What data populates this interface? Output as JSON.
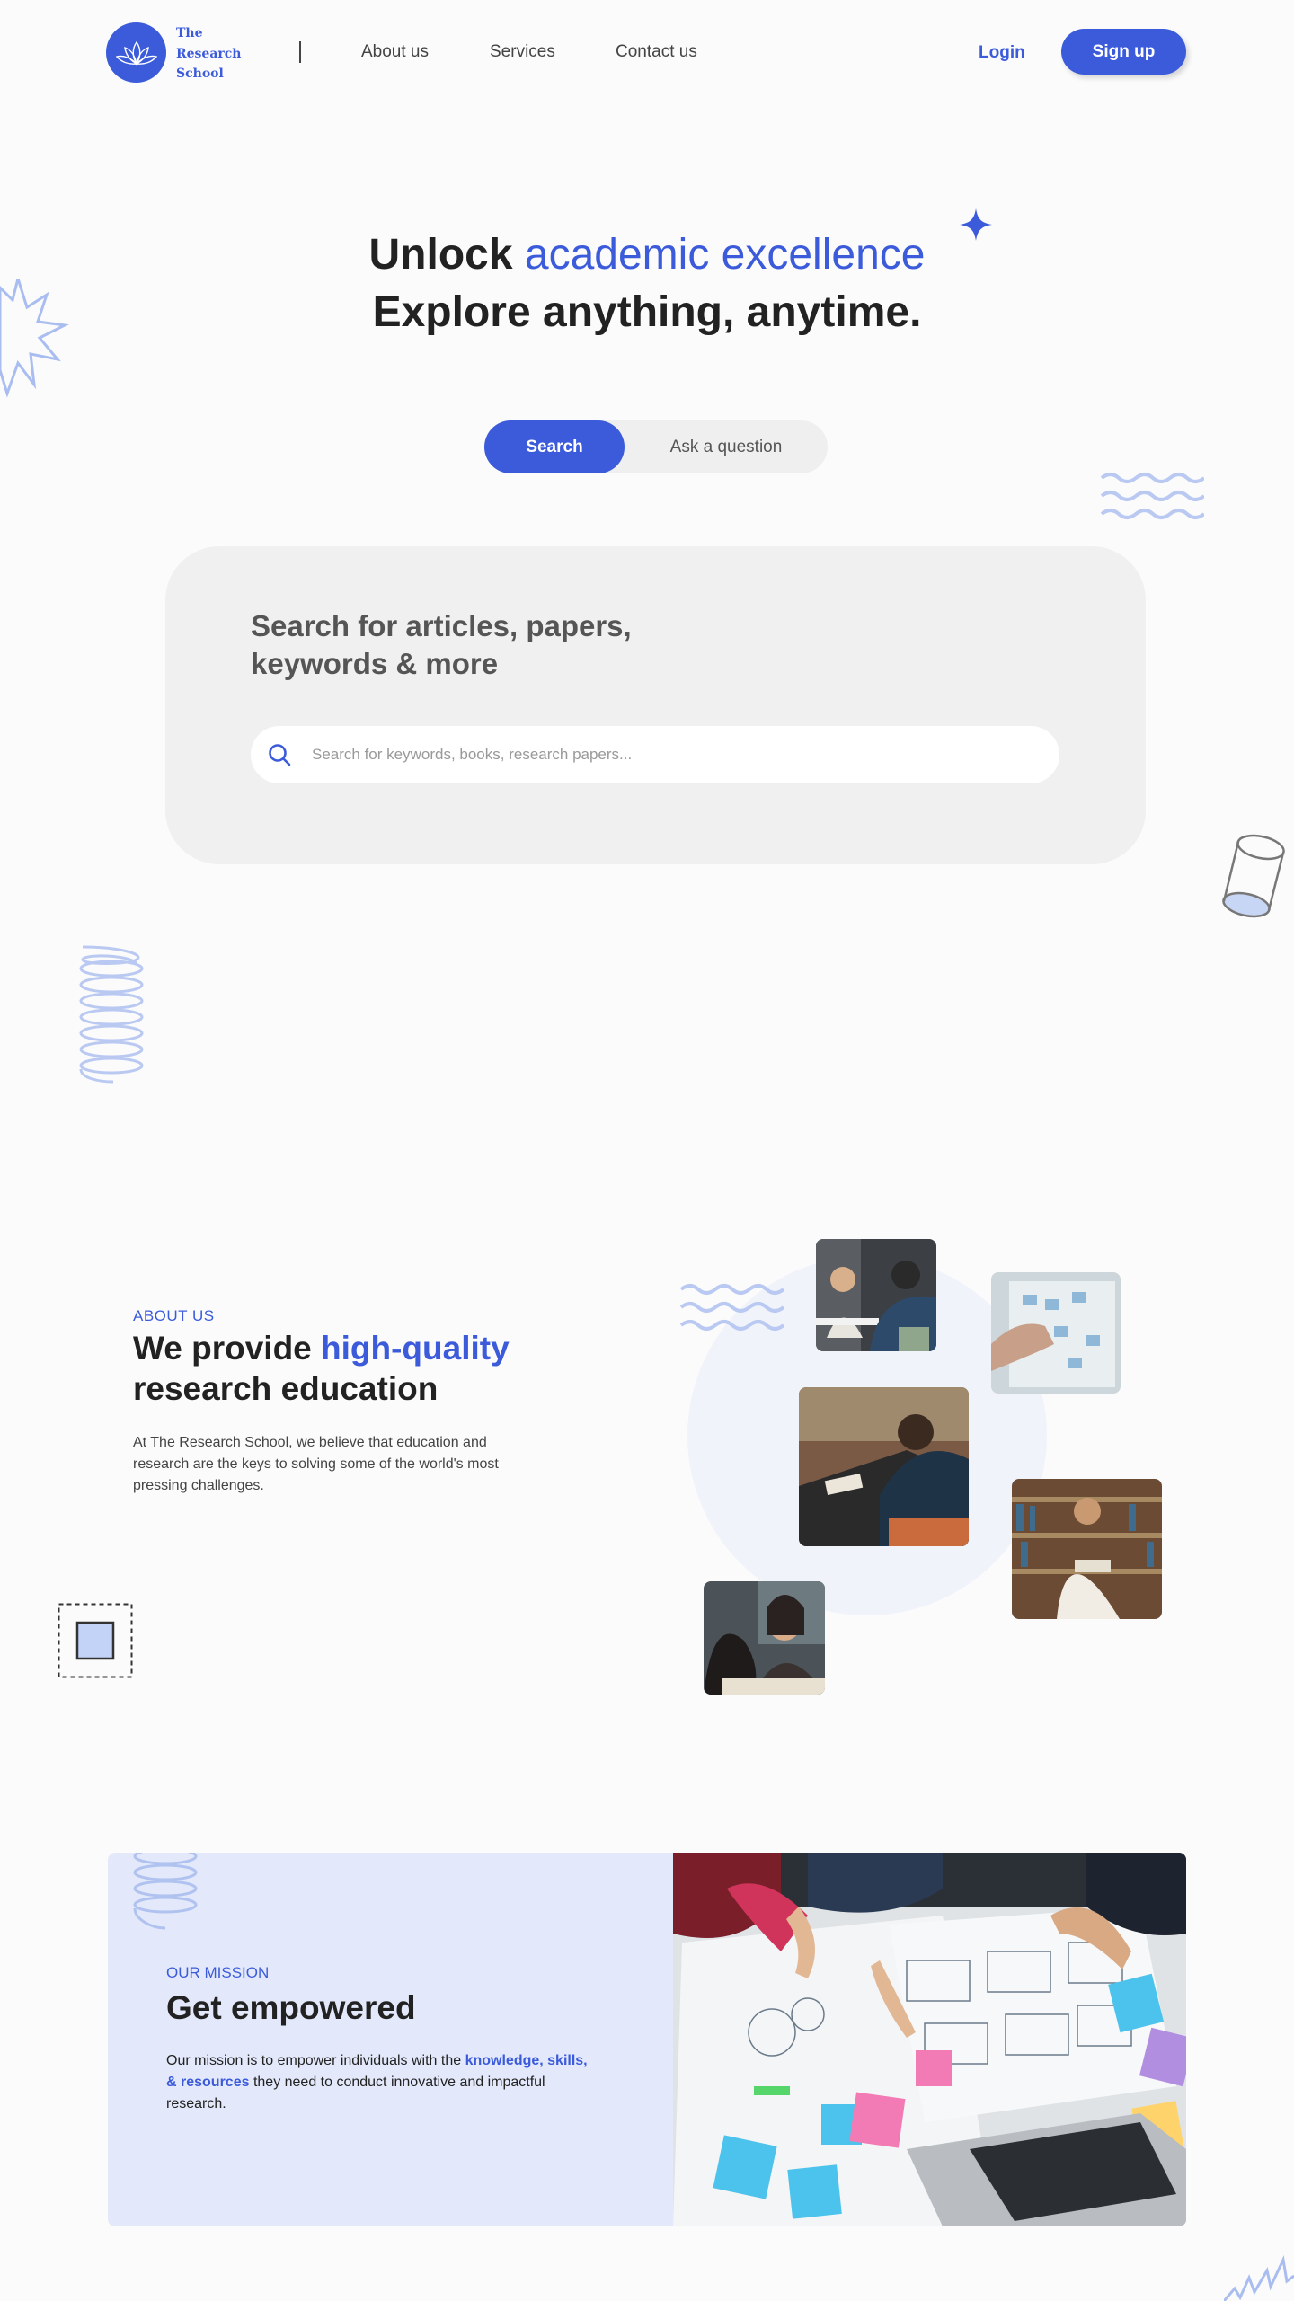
{
  "header": {
    "logo_text": [
      "The",
      "Research",
      "School"
    ],
    "nav": {
      "about": "About us",
      "services": "Services",
      "contact": "Contact us"
    },
    "login": "Login",
    "signup": "Sign up"
  },
  "hero": {
    "title_lead": "Unlock ",
    "title_accent": "academic excellence",
    "title_line2": "Explore anything, anytime."
  },
  "toggle": {
    "search": "Search",
    "ask": "Ask a question"
  },
  "search_card": {
    "title": "Search for articles, papers, keywords & more",
    "placeholder": "Search for keywords, books, research papers..."
  },
  "about": {
    "kicker": "ABOUT US",
    "title_lead": "We provide ",
    "title_accent": "high-quality",
    "title_tail": "research education",
    "body": "At The Research School, we believe that education and research are the keys to solving some of the world's most pressing challenges."
  },
  "mission": {
    "kicker": "OUR MISSION",
    "title": "Get empowered",
    "body_lead": "Our mission is to empower individuals with the ",
    "body_highlight": "knowledge, skills, & resources",
    "body_tail": " they need to conduct innovative and impactful research."
  },
  "colors": {
    "accent": "#3b5bdb",
    "card": "#f0f0f0",
    "mission_bg": "#e3e9fa",
    "deco_light": "#b9c9f2"
  }
}
